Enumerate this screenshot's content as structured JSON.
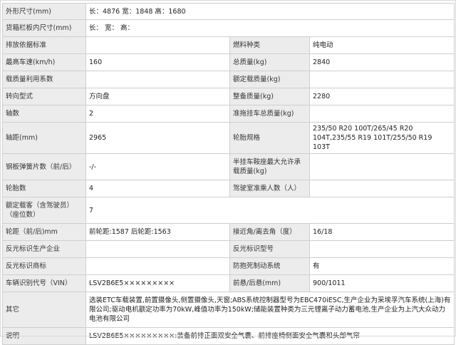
{
  "rows": [
    {
      "k": "外形尺寸(mm)",
      "v": "长：4876 宽：1848 高：1680"
    },
    {
      "k": "货箱栏板内尺寸(mm)",
      "v": "长： 宽： 高："
    },
    {
      "k1": "排放依据标准",
      "v1": "",
      "k2": "燃料种类",
      "v2": "纯电动"
    },
    {
      "k1": "最高车速(km/h)",
      "v1": "160",
      "k2": "总质量(kg)",
      "v2": "2840"
    },
    {
      "k1": "载质量利用系数",
      "v1": "",
      "k2": "额定载质量(kg)",
      "v2": ""
    },
    {
      "k1": "转向型式",
      "v1": "方向盘",
      "k2": "整备质量(kg)",
      "v2": "2280"
    },
    {
      "k1": "轴数",
      "v1": "2",
      "k2": "准拖挂车总质量(kg)",
      "v2": ""
    },
    {
      "k1": "轴距(mm)",
      "v1": "2965",
      "k2": "轮胎规格",
      "v2": "235/50 R20 100T/265/45 R20 104T,235/55 R19 101T/255/50 R19 103T"
    },
    {
      "k1": "钢板弹簧片数（前/后）",
      "v1": "-/-",
      "k2": "半挂车鞍座最大允许承载质量(kg)",
      "v2": ""
    },
    {
      "k1": "轮胎数",
      "v1": "4",
      "k2": "驾驶室准乘人数（人）",
      "v2": ""
    },
    {
      "k": "额定载客（含驾驶员）（座位数）",
      "v": "7"
    },
    {
      "k1": "轮距（前/后)mm",
      "v1": "前轮距:1587 后轮距:1563",
      "k2": "接近角/离去角（度）",
      "v2": "16/18"
    },
    {
      "k1": "反光标识生产企业",
      "v1": "",
      "k2": "反光标识型号",
      "v2": ""
    },
    {
      "k1": "反光标识商标",
      "v1": "",
      "k2": "防抱死制动系统",
      "v2": "有"
    },
    {
      "k1": "车辆识别代号（VIN）",
      "v1": "LSV2B6E5×××××××××",
      "k2": "前悬/后悬(mm)",
      "v2": "900/1011"
    },
    {
      "k": "其它",
      "v": "选装ETC车载装置,前置摄像头,侧置摄像头,天窗;ABS系统控制器型号为EBC470iESC,生产企业为采埃孚汽车系统(上海)有限公司;驱动电机额定功率为70kW,峰值功率为150kW;储能装置种类为三元锂离子动力蓄电池,生产企业为上汽大众动力电池有限公司"
    },
    {
      "k": "说明",
      "v": "LSV2B6E5×××××××××:装备前排正面双安全气囊、前排座椅侧面安全气囊和头部气帘"
    }
  ]
}
